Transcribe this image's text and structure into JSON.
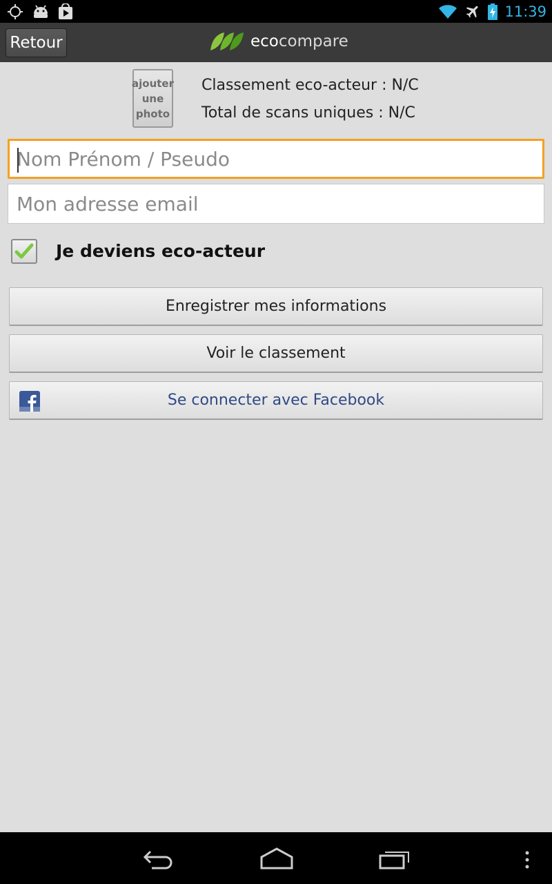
{
  "status_bar": {
    "time": "11:39",
    "left_icons": [
      "gps-icon",
      "android-icon",
      "play-store-icon"
    ],
    "right_icons": [
      "wifi-icon",
      "airplane-icon",
      "battery-charging-icon"
    ],
    "accent_color": "#33b5e5"
  },
  "action_bar": {
    "back_label": "Retour",
    "logo_eco": "eco",
    "logo_compare": "compare"
  },
  "profile": {
    "photo_line1": "ajouter",
    "photo_line2": "une",
    "photo_line3": "photo",
    "rank": "Classement eco-acteur : N/C",
    "scans": "Total de scans uniques : N/C"
  },
  "form": {
    "name_placeholder": "Nom Prénom / Pseudo",
    "name_value": "",
    "email_placeholder": "Mon adresse email",
    "email_value": "",
    "checkbox_label": "Je deviens eco-acteur",
    "checkbox_checked": true,
    "focus_color": "#f4a020"
  },
  "buttons": {
    "save": "Enregistrer mes informations",
    "ranking": "Voir le classement",
    "facebook": "Se connecter avec Facebook",
    "facebook_color": "#2e4a86"
  },
  "nav_bar": {
    "icons": [
      "back-icon",
      "home-icon",
      "recent-apps-icon",
      "menu-icon"
    ]
  }
}
